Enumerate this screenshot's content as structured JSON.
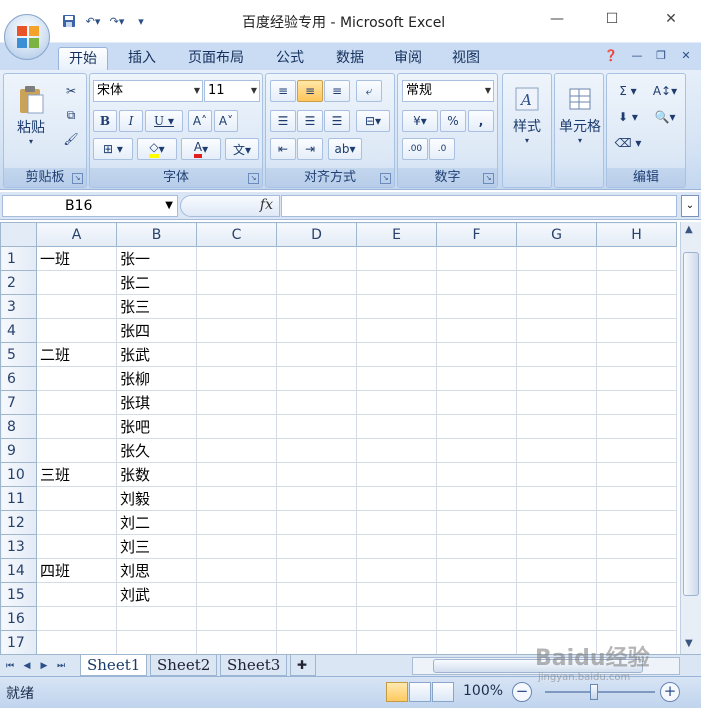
{
  "window": {
    "title": "百度经验专用 - Microsoft Excel",
    "minimize_icon": "minimize-icon",
    "maximize_icon": "maximize-icon",
    "close_icon": "close-icon"
  },
  "quick_access": {
    "save_icon": "save-icon",
    "undo_icon": "undo-icon",
    "redo_icon": "redo-icon",
    "customize_icon": "customize-icon"
  },
  "ribbon_tabs": [
    {
      "label": "开始",
      "active": true
    },
    {
      "label": "插入"
    },
    {
      "label": "页面布局"
    },
    {
      "label": "公式"
    },
    {
      "label": "数据"
    },
    {
      "label": "审阅"
    },
    {
      "label": "视图"
    }
  ],
  "ribbon": {
    "clipboard": {
      "label": "剪贴板",
      "paste_label": "粘贴"
    },
    "font": {
      "label": "字体",
      "font_name": "宋体",
      "font_size": "11"
    },
    "alignment": {
      "label": "对齐方式"
    },
    "number": {
      "label": "数字",
      "format": "常规",
      "percent": "%",
      "comma": ","
    },
    "styles": {
      "label": "样式"
    },
    "cells": {
      "label": "单元格"
    },
    "editing": {
      "label": "编辑"
    }
  },
  "formula_bar": {
    "name_box": "B16",
    "fx_label": "fx",
    "formula": ""
  },
  "grid": {
    "columns": [
      "A",
      "B",
      "C",
      "D",
      "E",
      "F",
      "G",
      "H"
    ],
    "rows": [
      {
        "num": "1",
        "A": "一班",
        "B": "张一"
      },
      {
        "num": "2",
        "A": "",
        "B": "张二"
      },
      {
        "num": "3",
        "A": "",
        "B": "张三"
      },
      {
        "num": "4",
        "A": "",
        "B": "张四"
      },
      {
        "num": "5",
        "A": "二班",
        "B": "张武"
      },
      {
        "num": "6",
        "A": "",
        "B": "张柳"
      },
      {
        "num": "7",
        "A": "",
        "B": "张琪"
      },
      {
        "num": "8",
        "A": "",
        "B": "张吧"
      },
      {
        "num": "9",
        "A": "",
        "B": "张久"
      },
      {
        "num": "10",
        "A": "三班",
        "B": "张数"
      },
      {
        "num": "11",
        "A": "",
        "B": "刘毅"
      },
      {
        "num": "12",
        "A": "",
        "B": "刘二"
      },
      {
        "num": "13",
        "A": "",
        "B": "刘三"
      },
      {
        "num": "14",
        "A": "四班",
        "B": "刘思"
      },
      {
        "num": "15",
        "A": "",
        "B": "刘武"
      },
      {
        "num": "16",
        "A": "",
        "B": ""
      },
      {
        "num": "17",
        "A": "",
        "B": ""
      }
    ]
  },
  "sheets": [
    {
      "label": "Sheet1",
      "active": true
    },
    {
      "label": "Sheet2"
    },
    {
      "label": "Sheet3"
    }
  ],
  "status_bar": {
    "status": "就绪",
    "zoom": "100%",
    "zoom_out": "−",
    "zoom_in": "+"
  },
  "watermark": {
    "text": "Baidu经验",
    "sub": "jingyan.baidu.com"
  }
}
